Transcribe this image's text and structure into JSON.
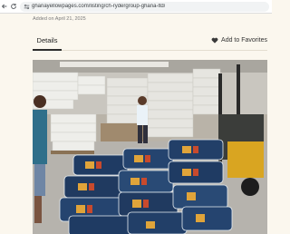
{
  "browser": {
    "url": "ghanayellowpages.com/listing/ch-rydergroup-ghana-ltd/"
  },
  "listing": {
    "added_on": "Added on April 21, 2025",
    "tabs": [
      {
        "label": "Details"
      }
    ],
    "favorites_label": "Add to Favorites"
  },
  "colors": {
    "page_background": "#fbf7ee",
    "accent_dark": "#2c2c2c"
  }
}
